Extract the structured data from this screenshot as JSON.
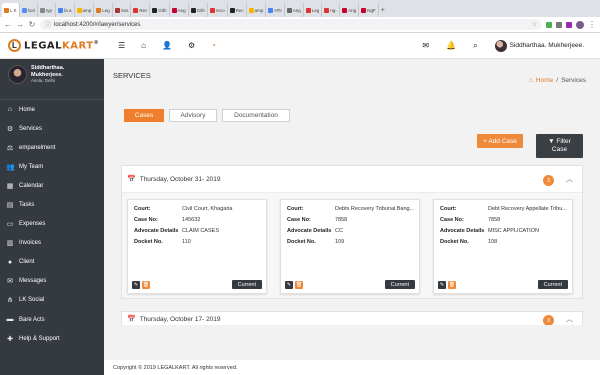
{
  "browser": {
    "tabs": [
      {
        "label": "L K",
        "color": "#e07a1f",
        "active": true
      },
      {
        "label": "loni",
        "color": "#5b8def"
      },
      {
        "label": "typ",
        "color": "#888"
      },
      {
        "label": "fa a",
        "color": "#4285f4"
      },
      {
        "label": "amp",
        "color": "#f4b400"
      },
      {
        "label": "Leg",
        "color": "#e07a1f"
      },
      {
        "label": "Sss",
        "color": "#a33"
      },
      {
        "label": "Rec",
        "color": "#d33"
      },
      {
        "label": "Gith",
        "color": "#222"
      },
      {
        "label": "Ang",
        "color": "#c3002f"
      },
      {
        "label": "Gith",
        "color": "#222"
      },
      {
        "label": "reco",
        "color": "#d33"
      },
      {
        "label": "Rec",
        "color": "#222"
      },
      {
        "label": "amp",
        "color": "#f4b400"
      },
      {
        "label": "HTI",
        "color": "#4285f4"
      },
      {
        "label": "Ang",
        "color": "#666"
      },
      {
        "label": "Leg",
        "color": "#d33"
      },
      {
        "label": "ng-",
        "color": "#d33"
      },
      {
        "label": "Ang",
        "color": "#c3002f"
      },
      {
        "label": "NgF",
        "color": "#c3002f"
      }
    ],
    "url": "localhost:4200/#/lawyer/services"
  },
  "header": {
    "logo_legal": "LEGAL",
    "logo_kart": "KART",
    "logo_reg": "®",
    "user_name": "Siddharthaa. Mukherjeee."
  },
  "sidebar": {
    "profile_name": "Siddharthaa. Mukherjeee.",
    "profile_location": "Asola, Delhi",
    "items": [
      {
        "label": "Home",
        "icon": "home-icon",
        "glyph": "⌂"
      },
      {
        "label": "Services",
        "icon": "services-icon",
        "glyph": "⚙"
      },
      {
        "label": "empanelment",
        "icon": "empanelment-icon",
        "glyph": "⚖"
      },
      {
        "label": "My Team",
        "icon": "team-icon",
        "glyph": "👥"
      },
      {
        "label": "Calendar",
        "icon": "calendar-icon",
        "glyph": "▦"
      },
      {
        "label": "Tasks",
        "icon": "tasks-icon",
        "glyph": "▤"
      },
      {
        "label": "Expenses",
        "icon": "expenses-icon",
        "glyph": "▭"
      },
      {
        "label": "Invoices",
        "icon": "invoices-icon",
        "glyph": "▥"
      },
      {
        "label": "Client",
        "icon": "client-icon",
        "glyph": "●"
      },
      {
        "label": "Messages",
        "icon": "messages-icon",
        "glyph": "✉"
      },
      {
        "label": "LK Social",
        "icon": "social-icon",
        "glyph": "⋔"
      },
      {
        "label": "Bare Acts",
        "icon": "bare-acts-icon",
        "glyph": "▬"
      },
      {
        "label": "Help & Support",
        "icon": "help-icon",
        "glyph": "✚"
      }
    ]
  },
  "main": {
    "title": "SERVICES",
    "breadcrumb_home": "Home",
    "breadcrumb_sep": "/",
    "breadcrumb_current": "Services",
    "tabs": [
      "Cases",
      "Advisory",
      "Documentation"
    ],
    "add_case": "+ Add Case",
    "filter_line1": "Filter",
    "filter_line2": "Case"
  },
  "groups": [
    {
      "date": "Thursday, October 31- 2019",
      "count": "3",
      "cards": [
        {
          "court": "Civil Court, Khagaria",
          "case_no": "145632",
          "advocate": "CLAIM CASES",
          "docket": "110"
        },
        {
          "court": "Debts Recovery Tribunal Bang...",
          "case_no": "7858",
          "advocate": "CC",
          "docket": "109"
        },
        {
          "court": "Debt Recovery Appellate Tribu...",
          "case_no": "7858",
          "advocate": "MISC APPLICATION",
          "docket": "108"
        }
      ]
    },
    {
      "date": "Thursday, October 17- 2019",
      "count": "3"
    }
  ],
  "labels": {
    "court": "Court:",
    "case_no": "Case No:",
    "advocate": "Advocate Details",
    "docket": "Docket No.",
    "current": "Current"
  },
  "footer": "Copyright © 2019 LEGALKART. All rights reserved.",
  "colors": {
    "accent": "#ef8a3b",
    "sidebar": "#343a40",
    "dark_button": "#3a3f44"
  }
}
